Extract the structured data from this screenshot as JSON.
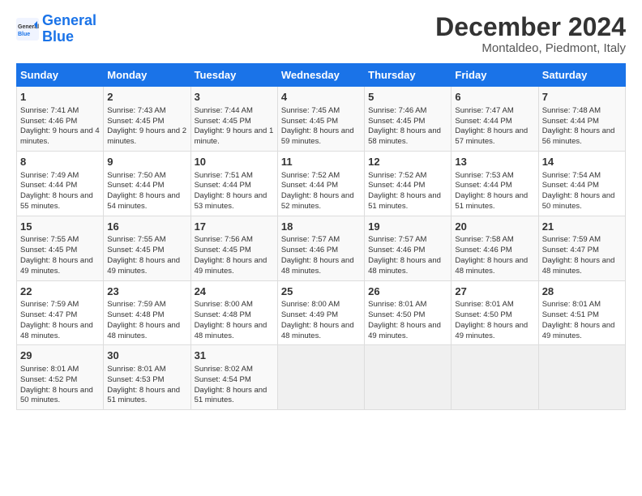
{
  "header": {
    "logo_line1": "General",
    "logo_line2": "Blue",
    "title": "December 2024",
    "subtitle": "Montaldeo, Piedmont, Italy"
  },
  "days_of_week": [
    "Sunday",
    "Monday",
    "Tuesday",
    "Wednesday",
    "Thursday",
    "Friday",
    "Saturday"
  ],
  "weeks": [
    [
      {
        "day": "1",
        "info": "Sunrise: 7:41 AM\nSunset: 4:46 PM\nDaylight: 9 hours and 4 minutes."
      },
      {
        "day": "2",
        "info": "Sunrise: 7:43 AM\nSunset: 4:45 PM\nDaylight: 9 hours and 2 minutes."
      },
      {
        "day": "3",
        "info": "Sunrise: 7:44 AM\nSunset: 4:45 PM\nDaylight: 9 hours and 1 minute."
      },
      {
        "day": "4",
        "info": "Sunrise: 7:45 AM\nSunset: 4:45 PM\nDaylight: 8 hours and 59 minutes."
      },
      {
        "day": "5",
        "info": "Sunrise: 7:46 AM\nSunset: 4:45 PM\nDaylight: 8 hours and 58 minutes."
      },
      {
        "day": "6",
        "info": "Sunrise: 7:47 AM\nSunset: 4:44 PM\nDaylight: 8 hours and 57 minutes."
      },
      {
        "day": "7",
        "info": "Sunrise: 7:48 AM\nSunset: 4:44 PM\nDaylight: 8 hours and 56 minutes."
      }
    ],
    [
      {
        "day": "8",
        "info": "Sunrise: 7:49 AM\nSunset: 4:44 PM\nDaylight: 8 hours and 55 minutes."
      },
      {
        "day": "9",
        "info": "Sunrise: 7:50 AM\nSunset: 4:44 PM\nDaylight: 8 hours and 54 minutes."
      },
      {
        "day": "10",
        "info": "Sunrise: 7:51 AM\nSunset: 4:44 PM\nDaylight: 8 hours and 53 minutes."
      },
      {
        "day": "11",
        "info": "Sunrise: 7:52 AM\nSunset: 4:44 PM\nDaylight: 8 hours and 52 minutes."
      },
      {
        "day": "12",
        "info": "Sunrise: 7:52 AM\nSunset: 4:44 PM\nDaylight: 8 hours and 51 minutes."
      },
      {
        "day": "13",
        "info": "Sunrise: 7:53 AM\nSunset: 4:44 PM\nDaylight: 8 hours and 51 minutes."
      },
      {
        "day": "14",
        "info": "Sunrise: 7:54 AM\nSunset: 4:44 PM\nDaylight: 8 hours and 50 minutes."
      }
    ],
    [
      {
        "day": "15",
        "info": "Sunrise: 7:55 AM\nSunset: 4:45 PM\nDaylight: 8 hours and 49 minutes."
      },
      {
        "day": "16",
        "info": "Sunrise: 7:55 AM\nSunset: 4:45 PM\nDaylight: 8 hours and 49 minutes."
      },
      {
        "day": "17",
        "info": "Sunrise: 7:56 AM\nSunset: 4:45 PM\nDaylight: 8 hours and 49 minutes."
      },
      {
        "day": "18",
        "info": "Sunrise: 7:57 AM\nSunset: 4:46 PM\nDaylight: 8 hours and 48 minutes."
      },
      {
        "day": "19",
        "info": "Sunrise: 7:57 AM\nSunset: 4:46 PM\nDaylight: 8 hours and 48 minutes."
      },
      {
        "day": "20",
        "info": "Sunrise: 7:58 AM\nSunset: 4:46 PM\nDaylight: 8 hours and 48 minutes."
      },
      {
        "day": "21",
        "info": "Sunrise: 7:59 AM\nSunset: 4:47 PM\nDaylight: 8 hours and 48 minutes."
      }
    ],
    [
      {
        "day": "22",
        "info": "Sunrise: 7:59 AM\nSunset: 4:47 PM\nDaylight: 8 hours and 48 minutes."
      },
      {
        "day": "23",
        "info": "Sunrise: 7:59 AM\nSunset: 4:48 PM\nDaylight: 8 hours and 48 minutes."
      },
      {
        "day": "24",
        "info": "Sunrise: 8:00 AM\nSunset: 4:48 PM\nDaylight: 8 hours and 48 minutes."
      },
      {
        "day": "25",
        "info": "Sunrise: 8:00 AM\nSunset: 4:49 PM\nDaylight: 8 hours and 48 minutes."
      },
      {
        "day": "26",
        "info": "Sunrise: 8:01 AM\nSunset: 4:50 PM\nDaylight: 8 hours and 49 minutes."
      },
      {
        "day": "27",
        "info": "Sunrise: 8:01 AM\nSunset: 4:50 PM\nDaylight: 8 hours and 49 minutes."
      },
      {
        "day": "28",
        "info": "Sunrise: 8:01 AM\nSunset: 4:51 PM\nDaylight: 8 hours and 49 minutes."
      }
    ],
    [
      {
        "day": "29",
        "info": "Sunrise: 8:01 AM\nSunset: 4:52 PM\nDaylight: 8 hours and 50 minutes."
      },
      {
        "day": "30",
        "info": "Sunrise: 8:01 AM\nSunset: 4:53 PM\nDaylight: 8 hours and 51 minutes."
      },
      {
        "day": "31",
        "info": "Sunrise: 8:02 AM\nSunset: 4:54 PM\nDaylight: 8 hours and 51 minutes."
      },
      null,
      null,
      null,
      null
    ]
  ]
}
